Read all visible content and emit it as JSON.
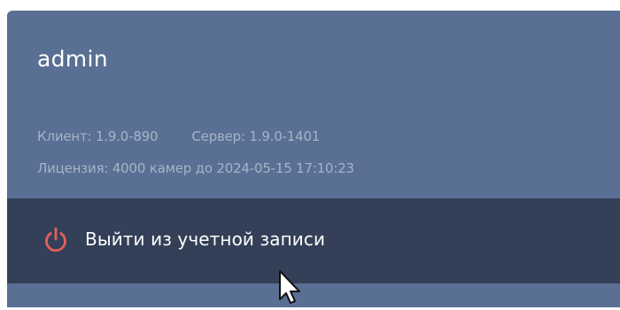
{
  "user": {
    "name": "admin"
  },
  "version": {
    "client": "Клиент: 1.9.0-890",
    "server": "Сервер: 1.9.0-1401"
  },
  "license": {
    "text": "Лицензия: 4000 камер до 2024-05-15 17:10:23"
  },
  "logout": {
    "label": "Выйти из учетной записи",
    "icon": "power-icon"
  },
  "colors": {
    "panel_bg": "#596f93",
    "logout_bg": "#334057",
    "power_icon": "#e4605a",
    "muted_text": "#a7b3c9"
  }
}
